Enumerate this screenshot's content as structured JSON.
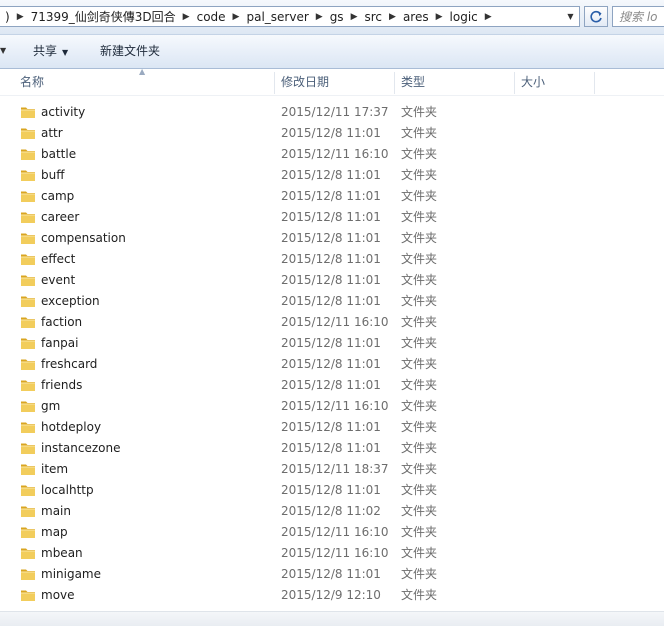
{
  "address_bar": {
    "crumbs": [
      ")",
      "71399_仙剑奇侠傳3D回合",
      "code",
      "pal_server",
      "gs",
      "src",
      "ares",
      "logic"
    ]
  },
  "search": {
    "placeholder": "搜索 lo"
  },
  "toolbar": {
    "share_label": "共享",
    "new_folder_label": "新建文件夹"
  },
  "columns": {
    "name": "名称",
    "date": "修改日期",
    "type": "类型",
    "size": "大小"
  },
  "files": [
    {
      "name": "activity",
      "date": "2015/12/11 17:37",
      "type": "文件夹"
    },
    {
      "name": "attr",
      "date": "2015/12/8 11:01",
      "type": "文件夹"
    },
    {
      "name": "battle",
      "date": "2015/12/11 16:10",
      "type": "文件夹"
    },
    {
      "name": "buff",
      "date": "2015/12/8 11:01",
      "type": "文件夹"
    },
    {
      "name": "camp",
      "date": "2015/12/8 11:01",
      "type": "文件夹"
    },
    {
      "name": "career",
      "date": "2015/12/8 11:01",
      "type": "文件夹"
    },
    {
      "name": "compensation",
      "date": "2015/12/8 11:01",
      "type": "文件夹"
    },
    {
      "name": "effect",
      "date": "2015/12/8 11:01",
      "type": "文件夹"
    },
    {
      "name": "event",
      "date": "2015/12/8 11:01",
      "type": "文件夹"
    },
    {
      "name": "exception",
      "date": "2015/12/8 11:01",
      "type": "文件夹"
    },
    {
      "name": "faction",
      "date": "2015/12/11 16:10",
      "type": "文件夹"
    },
    {
      "name": "fanpai",
      "date": "2015/12/8 11:01",
      "type": "文件夹"
    },
    {
      "name": "freshcard",
      "date": "2015/12/8 11:01",
      "type": "文件夹"
    },
    {
      "name": "friends",
      "date": "2015/12/8 11:01",
      "type": "文件夹"
    },
    {
      "name": "gm",
      "date": "2015/12/11 16:10",
      "type": "文件夹"
    },
    {
      "name": "hotdeploy",
      "date": "2015/12/8 11:01",
      "type": "文件夹"
    },
    {
      "name": "instancezone",
      "date": "2015/12/8 11:01",
      "type": "文件夹"
    },
    {
      "name": "item",
      "date": "2015/12/11 18:37",
      "type": "文件夹"
    },
    {
      "name": "localhttp",
      "date": "2015/12/8 11:01",
      "type": "文件夹"
    },
    {
      "name": "main",
      "date": "2015/12/8 11:02",
      "type": "文件夹"
    },
    {
      "name": "map",
      "date": "2015/12/11 16:10",
      "type": "文件夹"
    },
    {
      "name": "mbean",
      "date": "2015/12/11 16:10",
      "type": "文件夹"
    },
    {
      "name": "minigame",
      "date": "2015/12/8 11:01",
      "type": "文件夹"
    },
    {
      "name": "move",
      "date": "2015/12/9 12:10",
      "type": "文件夹"
    }
  ],
  "colors": {
    "folder": "#e8b83a",
    "accent": "#2a5ea8"
  }
}
